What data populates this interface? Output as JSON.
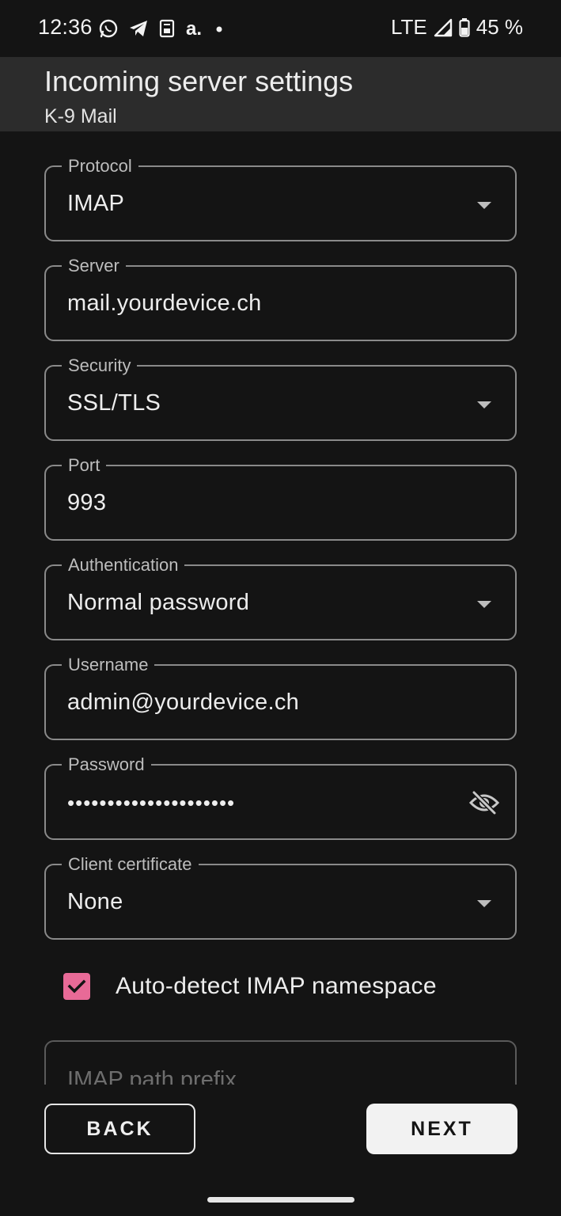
{
  "status_bar": {
    "time": "12:36",
    "network": "LTE",
    "battery": "45 %",
    "left_icons": [
      "whatsapp-icon",
      "telegram-icon",
      "sim-card-icon",
      "a-app-icon",
      "notification-dot-icon"
    ]
  },
  "app_bar": {
    "title": "Incoming server settings",
    "subtitle": "K-9 Mail"
  },
  "form": {
    "protocol": {
      "label": "Protocol",
      "value": "IMAP"
    },
    "server": {
      "label": "Server",
      "value": "mail.yourdevice.ch"
    },
    "security": {
      "label": "Security",
      "value": "SSL/TLS"
    },
    "port": {
      "label": "Port",
      "value": "993"
    },
    "authentication": {
      "label": "Authentication",
      "value": "Normal password"
    },
    "username": {
      "label": "Username",
      "value": "admin@yourdevice.ch"
    },
    "password": {
      "label": "Password",
      "value": "•••••••••••••••••••••"
    },
    "client_certificate": {
      "label": "Client certificate",
      "value": "None"
    },
    "auto_detect": {
      "label": "Auto-detect IMAP namespace",
      "checked": true
    },
    "path_prefix": {
      "placeholder": "IMAP path prefix"
    }
  },
  "buttons": {
    "back": "BACK",
    "next": "NEXT"
  },
  "colors": {
    "accent": "#e86a97",
    "background": "#141414",
    "app_bar": "#2c2c2c"
  }
}
